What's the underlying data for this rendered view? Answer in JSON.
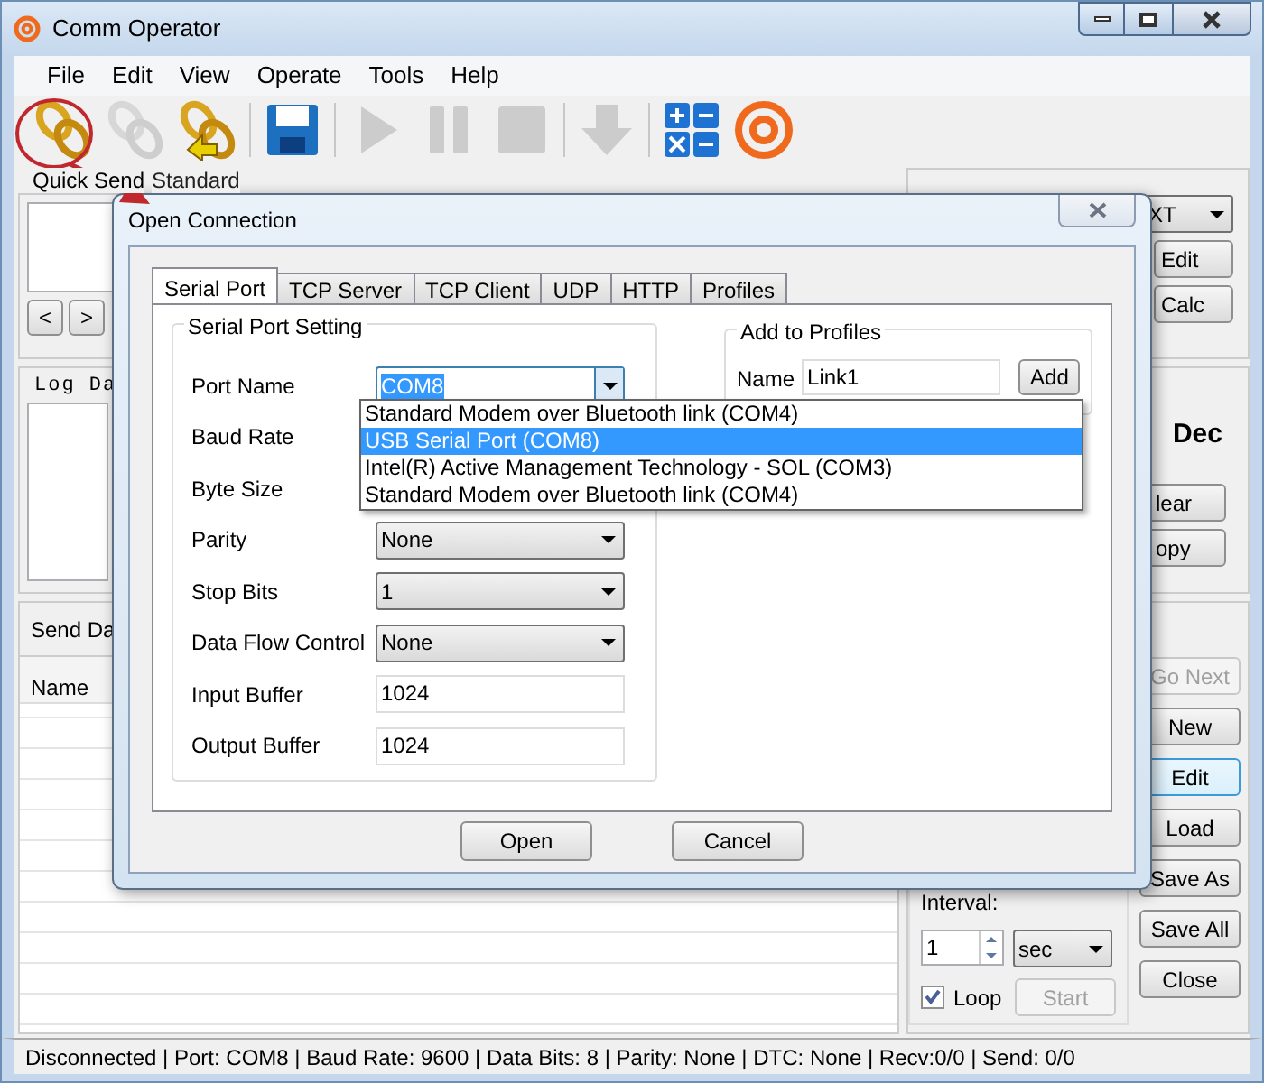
{
  "window": {
    "title": "Comm Operator"
  },
  "menu": [
    "File",
    "Edit",
    "View",
    "Operate",
    "Tools",
    "Help"
  ],
  "toolbar": [
    {
      "kind": "link",
      "disabled": false
    },
    {
      "kind": "unlink",
      "disabled": true
    },
    {
      "kind": "relink",
      "disabled": false
    },
    {
      "kind": "save",
      "disabled": false
    },
    {
      "kind": "play",
      "disabled": true
    },
    {
      "kind": "pause",
      "disabled": true
    },
    {
      "kind": "stop",
      "disabled": true
    },
    {
      "kind": "down",
      "disabled": true
    },
    {
      "kind": "calc",
      "disabled": false
    },
    {
      "kind": "logo",
      "disabled": false
    }
  ],
  "quick_send": {
    "tabs": [
      {
        "label": "Quick Send",
        "selected": true
      },
      {
        "label": "Standard",
        "selected": false
      }
    ],
    "nav": [
      "<",
      ">"
    ]
  },
  "log_panel": {
    "title": "Log Da"
  },
  "send_panel": {
    "tab": "Send Da",
    "columns": [
      "Name"
    ]
  },
  "right_top": {
    "format": "XT",
    "buttons": [
      "Edit",
      "Calc"
    ]
  },
  "right_log": {
    "radio": "Dec",
    "buttons": [
      "lear",
      "opy"
    ]
  },
  "send_buttons": [
    {
      "label": "Go Next",
      "disabled": true,
      "focused": false
    },
    {
      "label": "New",
      "disabled": false,
      "focused": false
    },
    {
      "label": "Edit",
      "disabled": false,
      "focused": true
    },
    {
      "label": "Load",
      "disabled": false,
      "focused": false
    },
    {
      "label": "Save As",
      "disabled": false,
      "focused": false
    },
    {
      "label": "Save All",
      "disabled": false,
      "focused": false
    },
    {
      "label": "Close",
      "disabled": false,
      "focused": false
    }
  ],
  "interval": {
    "label": "Interval:",
    "value": "1",
    "unit": "sec"
  },
  "loop": {
    "label": "Loop",
    "checked": true
  },
  "start": {
    "label": "Start",
    "disabled": true
  },
  "status_bar": "Disconnected | Port: COM8 | Baud Rate: 9600 | Data Bits: 8 | Parity: None | DTC: None | Recv:0/0 | Send: 0/0",
  "dialog": {
    "title": "Open Connection",
    "tabs": [
      {
        "label": "Serial Port",
        "selected": true
      },
      {
        "label": "TCP Server",
        "selected": false
      },
      {
        "label": "TCP Client",
        "selected": false
      },
      {
        "label": "UDP",
        "selected": false
      },
      {
        "label": "HTTP",
        "selected": false
      },
      {
        "label": "Profiles",
        "selected": false
      }
    ],
    "serial": {
      "title": "Serial Port Setting",
      "fields": [
        {
          "label": "Port Name",
          "kind": "combo",
          "value": "COM8",
          "open": true
        },
        {
          "label": "Baud Rate",
          "kind": "covered"
        },
        {
          "label": "Byte Size",
          "kind": "covered"
        },
        {
          "label": "Parity",
          "kind": "select",
          "value": "None"
        },
        {
          "label": "Stop Bits",
          "kind": "select",
          "value": "1"
        },
        {
          "label": "Data Flow Control",
          "kind": "select",
          "value": "None"
        },
        {
          "label": "Input Buffer",
          "kind": "text",
          "value": "1024"
        },
        {
          "label": "Output Buffer",
          "kind": "text",
          "value": "1024"
        }
      ]
    },
    "profiles": {
      "title": "Add to Profiles",
      "label": "Name",
      "value": "Link1",
      "button": "Add"
    },
    "buttons": [
      "Open",
      "Cancel"
    ],
    "port_list": [
      {
        "label": "Standard Modem over Bluetooth link (COM4)",
        "selected": false
      },
      {
        "label": "USB Serial Port (COM8)",
        "selected": true
      },
      {
        "label": "Intel(R) Active Management Technology - SOL (COM3)",
        "selected": false
      },
      {
        "label": "Standard Modem over Bluetooth link (COM4)",
        "selected": false
      }
    ]
  }
}
